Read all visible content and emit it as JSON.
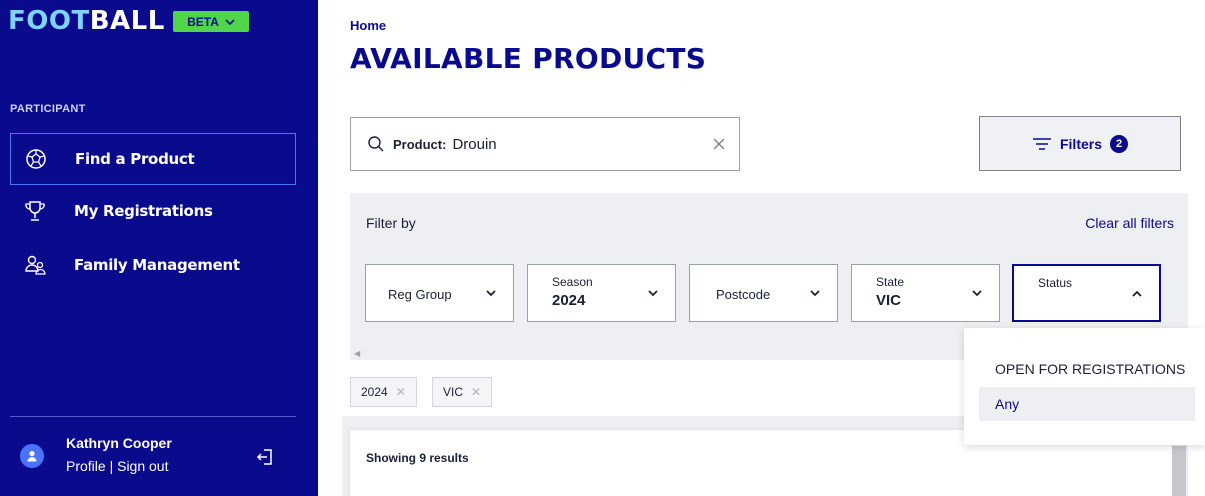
{
  "sidebar": {
    "logo": {
      "part1": "FOOT",
      "part2": "BALL"
    },
    "beta_label": "BETA",
    "section_label": "PARTICIPANT",
    "items": [
      {
        "label": "Find a Product",
        "icon": "soccer-ball-icon",
        "active": true
      },
      {
        "label": "My Registrations",
        "icon": "trophy-icon",
        "active": false
      },
      {
        "label": "Family Management",
        "icon": "family-icon",
        "active": false
      }
    ],
    "user": {
      "name": "Kathryn Cooper",
      "profile": "Profile",
      "sep": " | ",
      "signout": "Sign out"
    }
  },
  "header": {
    "breadcrumb": "Home",
    "title": "AVAILABLE PRODUCTS"
  },
  "search": {
    "prefix": "Product:",
    "value": "Drouin"
  },
  "filters_button": {
    "label": "Filters",
    "count": "2"
  },
  "filter_panel": {
    "heading": "Filter by",
    "clear_all": "Clear all filters",
    "selects": [
      {
        "label": "Reg Group",
        "value": ""
      },
      {
        "label": "Season",
        "value": "2024"
      },
      {
        "label": "Postcode",
        "value": ""
      },
      {
        "label": "State",
        "value": "VIC"
      },
      {
        "label": "Status",
        "value": "",
        "open": true
      }
    ]
  },
  "chips": [
    "2024",
    "VIC"
  ],
  "results": {
    "text": "Showing 9 results"
  },
  "status_dropdown": {
    "header": "OPEN FOR REGISTRATIONS",
    "options": [
      "Any"
    ]
  },
  "colors": {
    "sidebar": "#0a0a8c",
    "accent": "#0a0a8c",
    "beta": "#4fd64a",
    "logo_accent": "#7fd3ff"
  }
}
